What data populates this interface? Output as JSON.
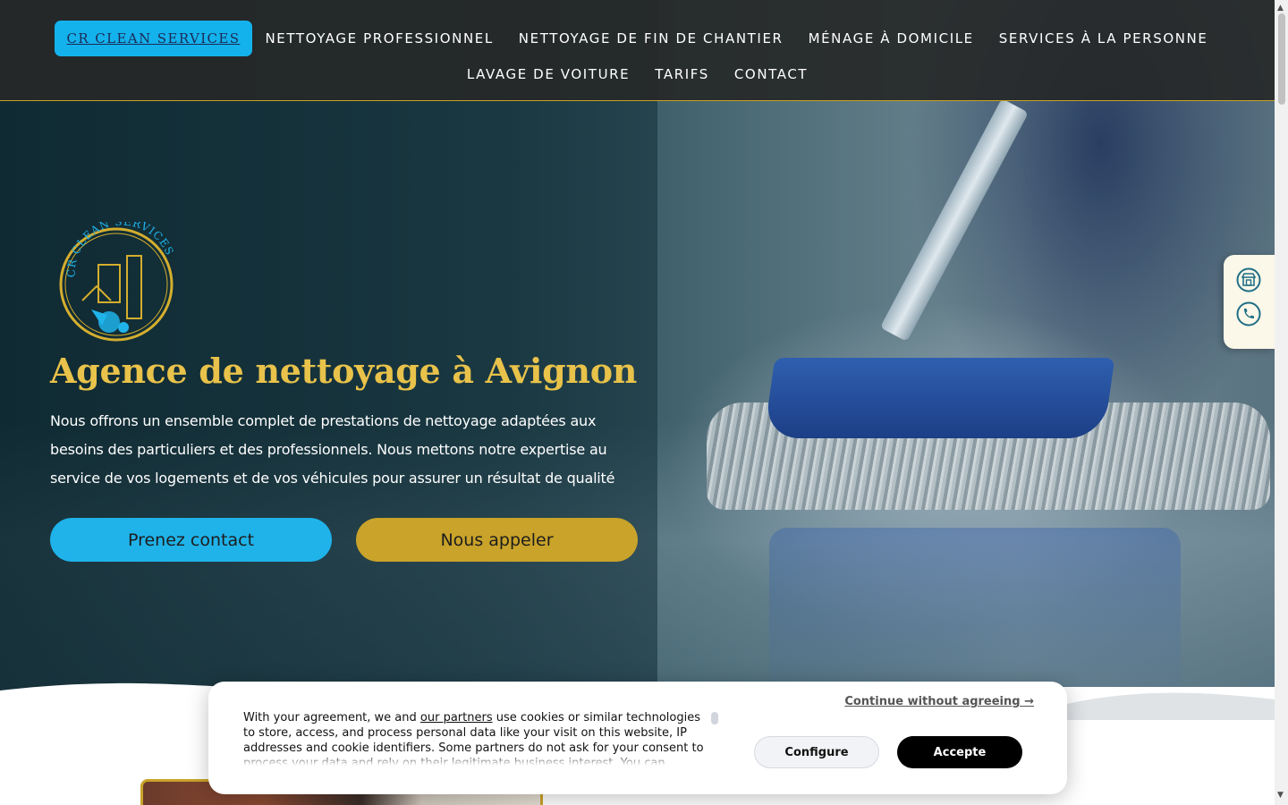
{
  "nav": {
    "brand": "CR Clean Services",
    "row1": [
      "Nettoyage professionnel",
      "Nettoyage de fin de chantier",
      "Ménage à domicile",
      "Services à la personne"
    ],
    "row2": [
      "Lavage de voiture",
      "Tarifs",
      "Contact"
    ]
  },
  "hero": {
    "logo_text": "CR CLEAN SERVICES",
    "title": "Agence de nettoyage à Avignon",
    "description": "Nous offrons un ensemble complet de prestations de nettoyage adaptées aux besoins des particuliers et des professionnels. Nous mettons notre expertise au service de vos logements et de vos véhicules pour assurer un résultat de qualité",
    "button_contact": "Prenez contact",
    "button_call": "Nous appeler"
  },
  "sidebar": {
    "icons": [
      "store-icon",
      "phone-icon"
    ]
  },
  "cookie": {
    "continue_label": "Continue without agreeing →",
    "text_before_link": "With your agreement, we and ",
    "link_text": "our partners",
    "text_after_link": " use cookies or similar technologies to store, access, and process personal data like your visit on this website, IP addresses and cookie identifiers. Some partners do not ask for your consent to process your data and rely on their legitimate business interest. You can",
    "configure_label": "Configure",
    "accept_label": "Accepte"
  },
  "colors": {
    "accent_blue": "#1fb3ea",
    "accent_gold": "#c9a32a",
    "title_gold": "#e8c24a",
    "nav_bg": "#262828"
  }
}
